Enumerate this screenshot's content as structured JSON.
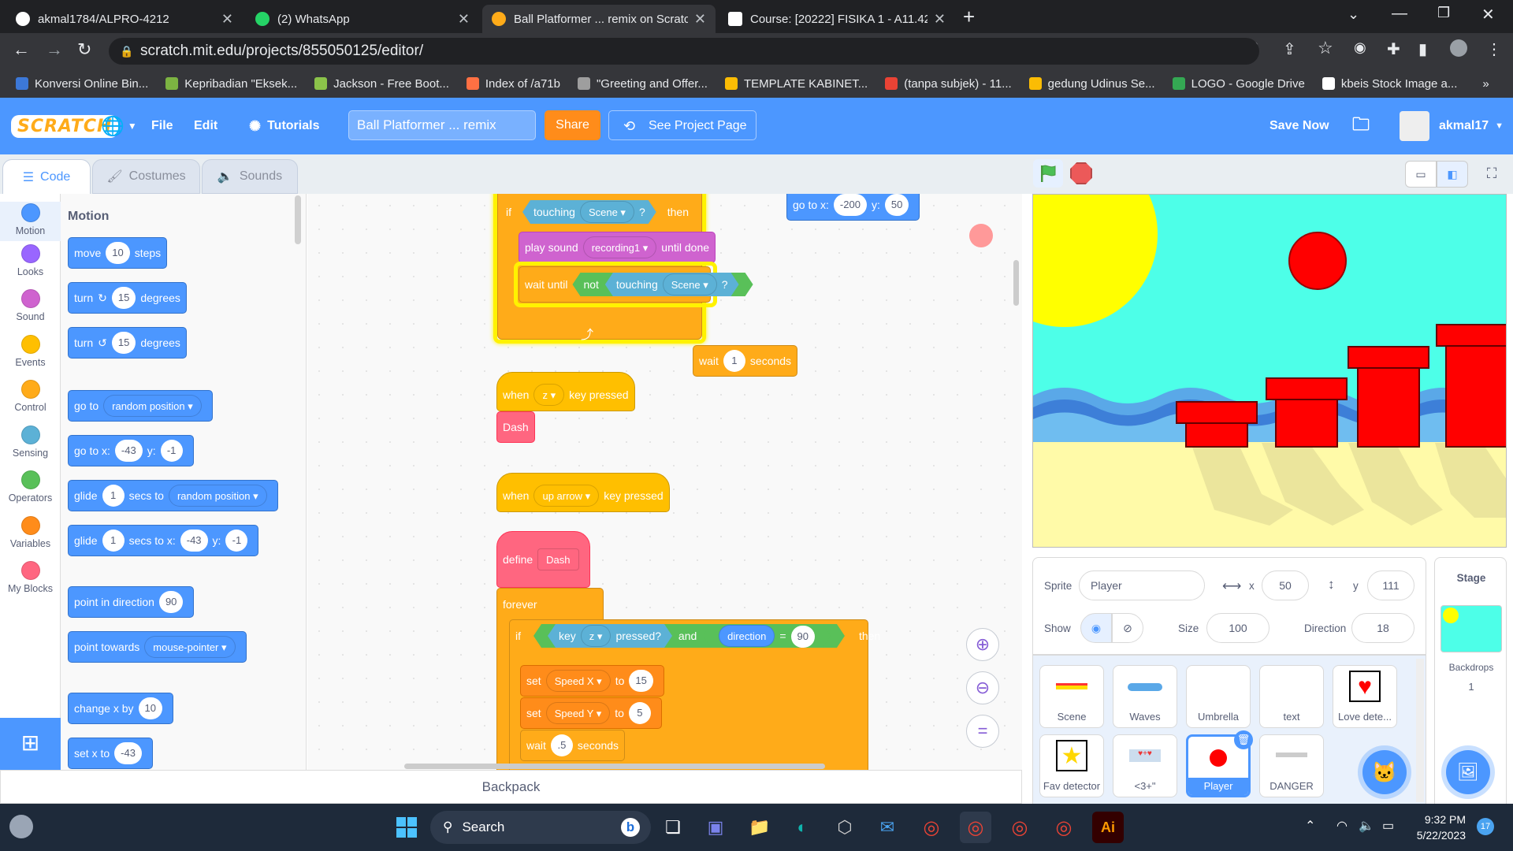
{
  "browser": {
    "tabs": [
      {
        "title": "akmal1784/ALPRO-4212",
        "color": "#ffffff"
      },
      {
        "title": "(2) WhatsApp",
        "color": "#25d366"
      },
      {
        "title": "Ball Platformer ... remix on Scratch",
        "color": "#ffab19"
      },
      {
        "title": "Course: [20222] FISIKA 1 - A11.42",
        "color": "#ffffff"
      }
    ],
    "url": "scratch.mit.edu/projects/855050125/editor/",
    "bookmarks": [
      {
        "label": "Konversi Online Bin...",
        "color": "#3c78d8"
      },
      {
        "label": "Kepribadian \"Eksek...",
        "color": "#7cb342"
      },
      {
        "label": "Jackson - Free Boot...",
        "color": "#8bc34a"
      },
      {
        "label": "Index of /a71b",
        "color": "#ff7043"
      },
      {
        "label": "\"Greeting and Offer...",
        "color": "#9e9e9e"
      },
      {
        "label": "TEMPLATE KABINET...",
        "color": "#fbbc04"
      },
      {
        "label": "(tanpa subjek) - 11...",
        "color": "#ea4335"
      },
      {
        "label": "gedung Udinus Se...",
        "color": "#fbbc04"
      },
      {
        "label": "LOGO - Google Drive",
        "color": "#34a853"
      },
      {
        "label": "kbeis Stock Image a...",
        "color": "#ffffff"
      }
    ]
  },
  "menu": {
    "logo": "SCRATCH",
    "file": "File",
    "edit": "Edit",
    "tutorials": "Tutorials",
    "project_title": "Ball Platformer ... remix",
    "share": "Share",
    "see_project": "See Project Page",
    "save_now": "Save Now",
    "username": "akmal17"
  },
  "tabs": {
    "code": "Code",
    "costumes": "Costumes",
    "sounds": "Sounds"
  },
  "categories": [
    {
      "label": "Motion",
      "color": "#4c97ff"
    },
    {
      "label": "Looks",
      "color": "#9966ff"
    },
    {
      "label": "Sound",
      "color": "#cf63cf"
    },
    {
      "label": "Events",
      "color": "#ffbf00"
    },
    {
      "label": "Control",
      "color": "#ffab19"
    },
    {
      "label": "Sensing",
      "color": "#5cb1d6"
    },
    {
      "label": "Operators",
      "color": "#59c059"
    },
    {
      "label": "Variables",
      "color": "#ff8c1a"
    },
    {
      "label": "My Blocks",
      "color": "#ff6680"
    }
  ],
  "palette": {
    "heading": "Motion",
    "move": {
      "a": "move",
      "n": "10",
      "b": "steps"
    },
    "turn_right": {
      "a": "turn",
      "n": "15",
      "b": "degrees"
    },
    "turn_left": {
      "a": "turn",
      "n": "15",
      "b": "degrees"
    },
    "goto_random": {
      "a": "go to",
      "d": "random position"
    },
    "goto_xy": {
      "a": "go to x:",
      "x": "-43",
      "y_label": "y:",
      "y": "-1"
    },
    "glide_random": {
      "a": "glide",
      "n": "1",
      "b": "secs to",
      "d": "random position"
    },
    "glide_xy": {
      "a": "glide",
      "n": "1",
      "b": "secs to x:",
      "x": "-43",
      "y_label": "y:",
      "y": "-1"
    },
    "point_dir": {
      "a": "point in direction",
      "n": "90"
    },
    "point_towards": {
      "a": "point towards",
      "d": "mouse-pointer"
    },
    "change_x": {
      "a": "change x by",
      "n": "10"
    },
    "set_x": {
      "a": "set x to",
      "n": "-43"
    }
  },
  "script": {
    "if1": {
      "if": "if",
      "touching": "touching",
      "scene": "Scene",
      "q": "?",
      "then": "then"
    },
    "play_sound": {
      "a": "play sound",
      "d": "recording1",
      "b": "until done"
    },
    "wait_until": {
      "a": "wait until",
      "not": "not",
      "touching": "touching",
      "scene": "Scene",
      "q": "?"
    },
    "goto_xy": {
      "a": "go to x:",
      "x": "-200",
      "y_label": "y:",
      "y": "50"
    },
    "wait1": {
      "a": "wait",
      "n": "1",
      "b": "seconds"
    },
    "when_z": {
      "a": "when",
      "d": "z",
      "b": "key pressed"
    },
    "dash_call": "Dash",
    "when_up": {
      "a": "when",
      "d": "up arrow",
      "b": "key pressed"
    },
    "define": {
      "a": "define",
      "name": "Dash"
    },
    "forever": "forever",
    "if2": {
      "if": "if",
      "key": "key",
      "d": "z",
      "pressed": "pressed?",
      "and": "and",
      "direction": "direction",
      "eq": "=",
      "n": "90",
      "then": "then"
    },
    "set1": {
      "a": "set",
      "d": "Speed X",
      "to": "to",
      "n": "15"
    },
    "set2": {
      "a": "set",
      "d": "Speed Y",
      "to": "to",
      "n": "5"
    },
    "wait2": {
      "a": "wait",
      "n": ".5",
      "b": "seconds"
    }
  },
  "backpack": "Backpack",
  "sprite": {
    "label": "Sprite",
    "name": "Player",
    "x_label": "x",
    "x": "50",
    "y_label": "y",
    "y": "111",
    "show_label": "Show",
    "size_label": "Size",
    "size": "100",
    "direction_label": "Direction",
    "direction": "18"
  },
  "sprites": [
    {
      "name": "Scene"
    },
    {
      "name": "Waves"
    },
    {
      "name": "Umbrella"
    },
    {
      "name": "text"
    },
    {
      "name": "Love dete..."
    },
    {
      "name": "Fav detector"
    },
    {
      "name": "<3+\""
    },
    {
      "name": "Player"
    },
    {
      "name": "DANGER"
    }
  ],
  "stage_panel": {
    "title": "Stage",
    "backdrops_label": "Backdrops",
    "backdrops": "1"
  },
  "taskbar": {
    "search": "Search",
    "time": "9:32 PM",
    "date": "5/22/2023",
    "notif": "17"
  }
}
